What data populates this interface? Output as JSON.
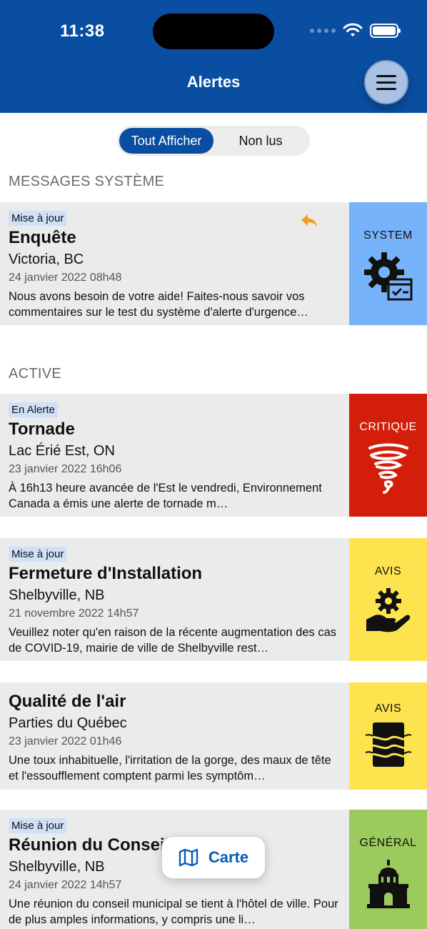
{
  "status_bar": {
    "time": "11:38"
  },
  "header": {
    "title": "Alertes"
  },
  "filter": {
    "all_label": "Tout Afficher",
    "unread_label": "Non lus"
  },
  "sections": {
    "system": "MESSAGES SYSTÈME",
    "active": "ACTIVE"
  },
  "cards": [
    {
      "badge": "Mise à jour",
      "title": "Enquête",
      "location": "Victoria, BC",
      "date": "24 janvier 2022 08h48",
      "description": "Nous avons besoin de votre aide! Faites-nous savoir vos commentaires sur le test du système d'alerte d'urgence…",
      "category": "SYSTEM",
      "category_color": "#77b3fb",
      "icon": "gear-checklist-icon"
    },
    {
      "badge": "En Alerte",
      "title": "Tornade",
      "location": "Lac Érié Est, ON",
      "date": "23 janvier 2022 16h06",
      "description": "À 16h13 heure avancée de l'Est le vendredi, Environnement Canada a émis une alerte de tornade m…",
      "category": "CRITIQUE",
      "category_color": "#d21e0b",
      "icon": "tornado-icon"
    },
    {
      "badge": "Mise à jour",
      "title": "Fermeture d'Installation",
      "location": "Shelbyville, NB",
      "date": "21 novembre 2022 14h57",
      "description": "Veuillez noter qu'en raison de la récente augmentation des cas de COVID-19, mairie de ville de Shelbyville rest…",
      "category": "AVIS",
      "category_color": "#fde34e",
      "icon": "hand-gear-icon"
    },
    {
      "title": "Qualité de l'air",
      "location": "Parties du Québec",
      "date": "23 janvier 2022 01h46",
      "description": "Une toux inhabituelle, l'irritation de la gorge, des maux de tête et l'essoufflement comptent parmi les symptôm…",
      "category": "AVIS",
      "category_color": "#fde34e",
      "icon": "air-quality-icon"
    },
    {
      "badge": "Mise à jour",
      "title": "Réunion du Conseil",
      "location": "Shelbyville, NB",
      "date": "24 janvier 2022 14h57",
      "description": "Une réunion du conseil municipal se tient à l'hôtel de ville. Pour de plus amples informations, y compris une li…",
      "category": "GÉNÉRAL",
      "category_color": "#9ccb5d",
      "icon": "city-hall-icon"
    }
  ],
  "map_button": {
    "label": "Carte"
  },
  "colors": {
    "header": "#0a4ea2",
    "accent": "#0a5ab8",
    "reply_icon": "#f39c1f"
  }
}
